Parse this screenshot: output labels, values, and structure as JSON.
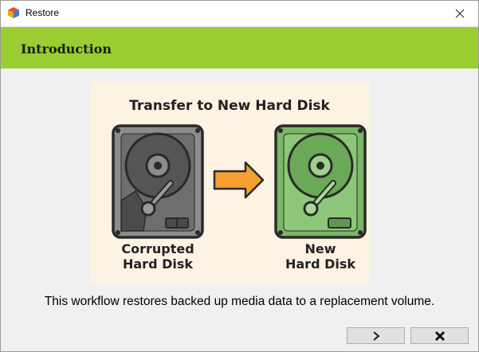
{
  "window": {
    "title": "Restore"
  },
  "header": {
    "title": "Introduction"
  },
  "illustration": {
    "heading": "Transfer to New Hard Disk",
    "source_label_line1": "Corrupted",
    "source_label_line2": "Hard Disk",
    "target_label_line1": "New",
    "target_label_line2": "Hard Disk"
  },
  "body": {
    "caption": "This workflow restores backed up media data to a replacement volume."
  },
  "buttons": {
    "next_icon": "chevron-right-icon",
    "cancel_icon": "x-icon"
  },
  "colors": {
    "accent": "#9acd32",
    "arrow": "#f5a030",
    "old_disk": "#8c8c8c",
    "new_disk": "#79b865",
    "illustration_bg": "#fcf3e2"
  }
}
